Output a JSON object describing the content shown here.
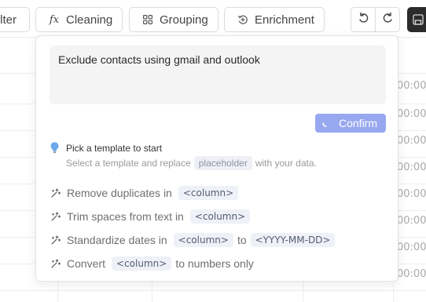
{
  "toolbar": {
    "filter_label": "lter",
    "cleaning": {
      "label": "Cleaning",
      "icon": "function-fx-icon"
    },
    "grouping": {
      "label": "Grouping",
      "icon": "grid-icon"
    },
    "enrichment": {
      "label": "Enrichment",
      "icon": "sparkle-refresh-icon"
    },
    "undo_icon": "undo-icon",
    "redo_icon": "redo-icon",
    "save_icon": "save-icon"
  },
  "background": {
    "time_cells": [
      "00:00",
      "00:00",
      "00:00",
      "00:00",
      "00:00",
      "00:00",
      "00:00",
      "00:00"
    ]
  },
  "popover": {
    "prompt_text": "Exclude contacts using gmail and outlook",
    "confirm_label": "Confirm",
    "template_title": "Pick a template to start",
    "template_desc_before": "Select a template and replace",
    "template_desc_tag": "placeholder",
    "template_desc_after": "with your data.",
    "templates": [
      {
        "text1": "Remove duplicates in",
        "ph1": "<column>"
      },
      {
        "text1": "Trim spaces from text in",
        "ph1": "<column>"
      },
      {
        "text1": "Standardize dates in",
        "ph1": "<column>",
        "text2": "to",
        "ph2": "<YYYY-MM-DD>"
      },
      {
        "text1": "Convert",
        "ph1": "<column>",
        "text2": "to numbers only"
      }
    ]
  },
  "colors": {
    "accent": "#98a8f0",
    "bulb": "#6aa8e8",
    "dark_button": "#2b2b2b"
  }
}
